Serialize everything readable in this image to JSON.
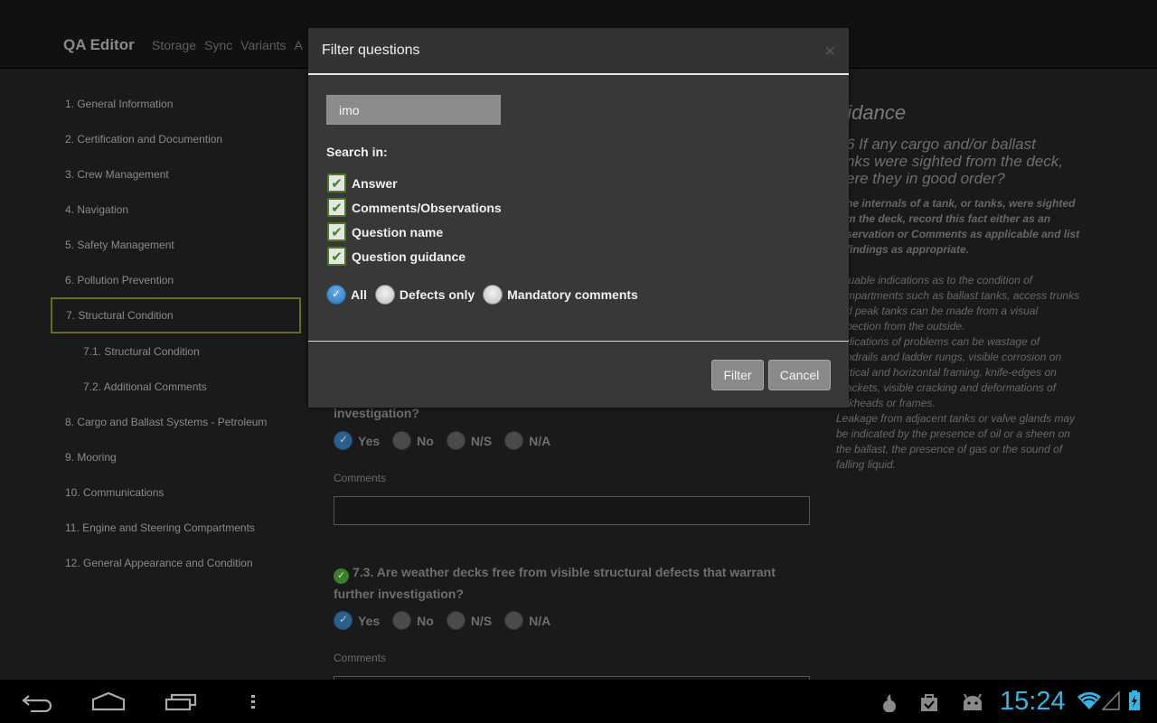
{
  "app": {
    "title": "QA Editor",
    "nav": [
      "Storage",
      "Sync",
      "Variants",
      "A"
    ]
  },
  "sidebar": {
    "items": [
      {
        "label": "1. General Information",
        "level": 0,
        "active": false
      },
      {
        "label": "2. Certification and Documention",
        "level": 0,
        "active": false
      },
      {
        "label": "3. Crew Management",
        "level": 0,
        "active": false
      },
      {
        "label": "4. Navigation",
        "level": 0,
        "active": false
      },
      {
        "label": "5. Safety Management",
        "level": 0,
        "active": false
      },
      {
        "label": "6. Pollution Prevention",
        "level": 0,
        "active": false
      },
      {
        "label": "7. Structural Condition",
        "level": 0,
        "active": true
      },
      {
        "label": "7.1. Structural Condition",
        "level": 1,
        "active": false
      },
      {
        "label": "7.2. Additional Comments",
        "level": 1,
        "active": false
      },
      {
        "label": "8. Cargo and Ballast Systems - Petroleum",
        "level": 0,
        "active": false
      },
      {
        "label": "9. Mooring",
        "level": 0,
        "active": false
      },
      {
        "label": "10. Communications",
        "level": 0,
        "active": false
      },
      {
        "label": "11. Engine and Steering Compartments",
        "level": 0,
        "active": false
      },
      {
        "label": "12. General Appearance and Condition",
        "level": 0,
        "active": false
      }
    ]
  },
  "main": {
    "questions": [
      {
        "text": "investigation?",
        "answers": [
          "Yes",
          "No",
          "N/S",
          "N/A"
        ],
        "selected": "Yes",
        "comments_label": "Comments",
        "comments_value": ""
      },
      {
        "text": "7.3. Are weather decks free from visible structural defects that warrant further investigation?",
        "status_icon": "check-circle-icon",
        "answers": [
          "Yes",
          "No",
          "N/S",
          "N/A"
        ],
        "selected": "Yes",
        "comments_label": "Comments"
      }
    ]
  },
  "guidance": {
    "title": "uidance",
    "question": "6 If any cargo and/or ballast\nnks were sighted from the deck,\nere they in good order?",
    "bold_text": "he internals of a tank, or tanks, were sighted\nm the deck, record this fact either as an\nservation or Comments as applicable and list\n findings as appropriate.",
    "body_visible": "luable indications as to the condition of\nmpartments such as ballast tanks, access trunks\nd peak tanks can be made from a visual\npection from the outside.\ndications of problems can be wastage of\nndrails and ladder rungs, visible corrosion on\nrtical and horizontal framing, knife-edges on\nackets, visible cracking and deformations of\nlkheads or frames.",
    "body_full": "Leakage from adjacent tanks or valve glands may\nbe indicated by the presence of oil or a sheen on\nthe ballast, the presence of gas or the sound of\nfalling liquid."
  },
  "dialog": {
    "title": "Filter questions",
    "close_icon": "close-icon",
    "search_value": "imo",
    "search_in_label": "Search in:",
    "checkboxes": [
      {
        "label": "Answer",
        "checked": true
      },
      {
        "label": "Comments/Observations",
        "checked": true
      },
      {
        "label": "Question name",
        "checked": true
      },
      {
        "label": "Question guidance",
        "checked": true
      }
    ],
    "radios": [
      {
        "label": "All",
        "selected": true
      },
      {
        "label": "Defects only",
        "selected": false
      },
      {
        "label": "Mandatory comments",
        "selected": false
      }
    ],
    "filter_label": "Filter",
    "cancel_label": "Cancel"
  },
  "system_bar": {
    "time": "15:24",
    "nav_icons": [
      "back-icon",
      "home-icon",
      "recent-apps-icon",
      "menu-icon"
    ],
    "status_icons": [
      "notification-drop-icon",
      "store-icon",
      "android-icon",
      "wifi-icon",
      "signal-icon",
      "battery-charging-icon"
    ],
    "accent": "#33b5e5"
  }
}
